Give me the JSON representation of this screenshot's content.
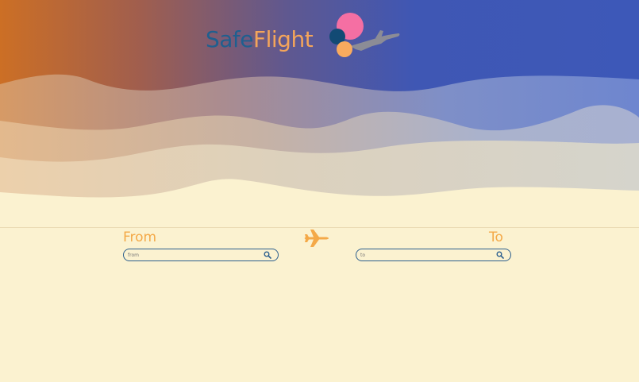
{
  "brand": {
    "name_part1": "Safe",
    "name_part2": "Flight",
    "logo_icon": "balloons-airplane-icon"
  },
  "colors": {
    "sunset_orange": "#cc6f25",
    "sky_blue": "#3d58b8",
    "sand": "#fbf2d0",
    "accent_orange": "#f4a948",
    "accent_navy": "#2c5f8e",
    "balloon_pink": "#f56fa3",
    "balloon_navy": "#124a74",
    "balloon_orange": "#f9ab5e",
    "airplane_gray": "#8c8c96"
  },
  "route": {
    "from_label": "From",
    "to_label": "To",
    "plane_icon": "airplane-icon",
    "from_search": {
      "placeholder": "from",
      "value": "",
      "icon": "search-icon"
    },
    "to_search": {
      "placeholder": "to",
      "value": "",
      "icon": "search-icon"
    }
  }
}
